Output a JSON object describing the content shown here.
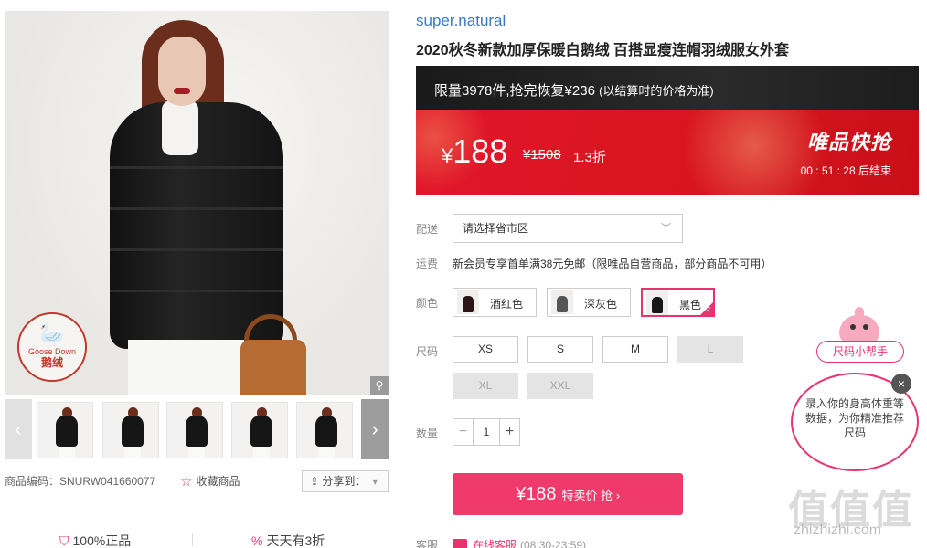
{
  "product": {
    "brand": "super.natural",
    "title": "2020秋冬新款加厚保暖白鹅绒 百搭显瘦连帽羽绒服女外套",
    "badge": {
      "line1": "Goose Down",
      "line2": "鹅绒"
    },
    "sku_label": "商品编码：SNURW041660077",
    "favorite_label": "收藏商品",
    "share_label": "分享到：",
    "guarantees": [
      "100%正品",
      "天天有3折"
    ]
  },
  "promo": {
    "limit_text": "限量3978件,抢完恢复¥236",
    "limit_note": "(以结算时的价格为准)",
    "price_currency": "¥",
    "price": "188",
    "original_price": "¥1508",
    "discount": "1.3折",
    "flash_title": "唯品快抢",
    "countdown": "00 : 51 : 28  后结束"
  },
  "delivery": {
    "label": "配送",
    "placeholder": "请选择省市区"
  },
  "shipping": {
    "label": "运费",
    "text": "新会员专享首单满38元免邮（限唯品自营商品，部分商品不可用）"
  },
  "colors": {
    "label": "颜色",
    "options": [
      {
        "name": "酒红色",
        "selected": false
      },
      {
        "name": "深灰色",
        "selected": false
      },
      {
        "name": "黑色",
        "selected": true
      }
    ]
  },
  "sizes": {
    "label": "尺码",
    "options": [
      {
        "name": "XS",
        "available": true
      },
      {
        "name": "S",
        "available": true
      },
      {
        "name": "M",
        "available": true
      },
      {
        "name": "L",
        "available": false
      },
      {
        "name": "XL",
        "available": false
      },
      {
        "name": "XXL",
        "available": false
      }
    ]
  },
  "quantity": {
    "label": "数量",
    "value": "1",
    "minus": "−",
    "plus": "+"
  },
  "buy": {
    "price": "¥188",
    "label": "特卖价 抢 ›"
  },
  "service": {
    "label": "客服",
    "link": "在线客服",
    "hours": "(08:30-23:59)"
  },
  "helper": {
    "tag": "尺码小帮手",
    "text": "录入你的身高体重等数据，为你精准推荐尺码",
    "close": "×"
  },
  "watermark": {
    "text": "值值值",
    "url": "zhizhizhi.com"
  },
  "icons": {
    "zoom": "magnifier-icon",
    "favorite": "star-icon",
    "share": "share-icon",
    "guarantee": "shield-icon",
    "discount": "percent-icon"
  },
  "colors_theme": {
    "accent": "#e8336f",
    "brand": "#3a78c3",
    "promo_red": "#d9141f"
  }
}
